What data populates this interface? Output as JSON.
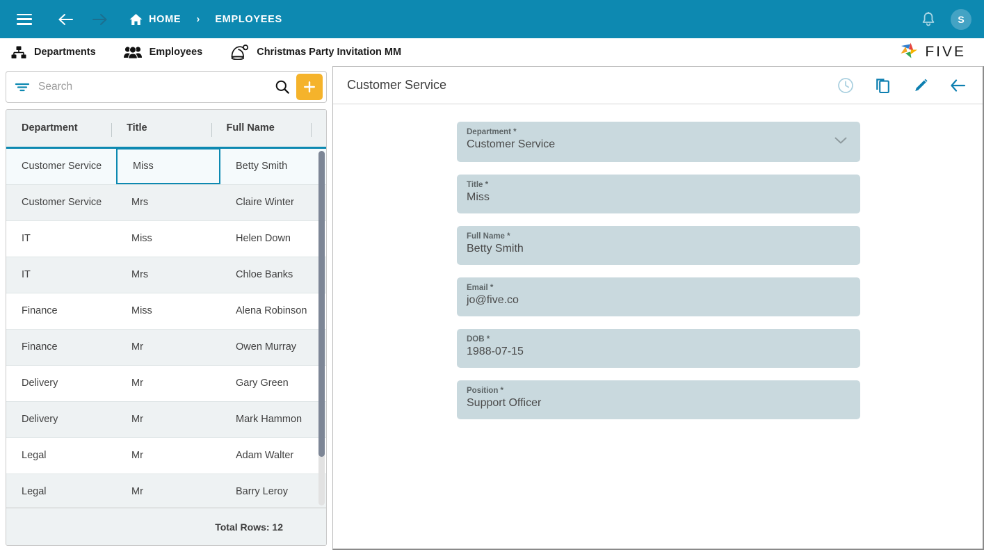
{
  "topbar": {
    "menu_icon": "hamburger-icon",
    "back_icon": "arrow-left-icon",
    "forward_icon": "arrow-right-icon",
    "home_icon": "home-icon",
    "home_label": "HOME",
    "separator": "›",
    "current_label": "EMPLOYEES",
    "notification_icon": "bell-icon",
    "avatar_initial": "S",
    "background_color": "#0d89b1"
  },
  "menubar": {
    "items": [
      {
        "label": "Departments",
        "icon": "sitemap-icon"
      },
      {
        "label": "Employees",
        "icon": "users-group-icon"
      },
      {
        "label": "Christmas Party Invitation MM",
        "icon": "santa-hat-icon"
      }
    ],
    "brand": {
      "name": "FIVE",
      "logo_icon": "five-pinwheel-logo",
      "colors": [
        "#2f7fd0",
        "#e8453c",
        "#f5b400",
        "#34a853"
      ]
    }
  },
  "search": {
    "filter_icon": "filter-icon",
    "placeholder": "Search",
    "value": "",
    "search_icon": "search-icon",
    "add_icon": "plus-icon",
    "add_button_color": "#f5b32b"
  },
  "grid": {
    "columns": [
      "Department",
      "Title",
      "Full Name"
    ],
    "rows": [
      {
        "department": "Customer Service",
        "title": "Miss",
        "full_name": "Betty Smith",
        "selected": true
      },
      {
        "department": "Customer Service",
        "title": "Mrs",
        "full_name": "Claire Winter",
        "selected": false
      },
      {
        "department": "IT",
        "title": "Miss",
        "full_name": "Helen Down",
        "selected": false
      },
      {
        "department": "IT",
        "title": "Mrs",
        "full_name": "Chloe Banks",
        "selected": false
      },
      {
        "department": "Finance",
        "title": "Miss",
        "full_name": "Alena Robinson",
        "selected": false
      },
      {
        "department": "Finance",
        "title": "Mr",
        "full_name": "Owen Murray",
        "selected": false
      },
      {
        "department": "Delivery",
        "title": "Mr",
        "full_name": "Gary Green",
        "selected": false
      },
      {
        "department": "Delivery",
        "title": "Mr",
        "full_name": "Mark Hammon",
        "selected": false
      },
      {
        "department": "Legal",
        "title": "Mr",
        "full_name": "Adam Walter",
        "selected": false
      },
      {
        "department": "Legal",
        "title": "Mr",
        "full_name": "Barry Leroy",
        "selected": false
      }
    ],
    "footer_text": "Total Rows: 12",
    "header_accent_color": "#0d89b1"
  },
  "detail": {
    "title": "Customer Service",
    "actions": [
      {
        "name": "history",
        "icon": "clock-icon"
      },
      {
        "name": "duplicate",
        "icon": "copy-icon"
      },
      {
        "name": "edit",
        "icon": "pencil-icon"
      },
      {
        "name": "back",
        "icon": "arrow-left-icon"
      }
    ],
    "fields": [
      {
        "label": "Department *",
        "value": "Customer Service",
        "type": "dropdown"
      },
      {
        "label": "Title *",
        "value": "Miss",
        "type": "text"
      },
      {
        "label": "Full Name *",
        "value": "Betty Smith",
        "type": "text"
      },
      {
        "label": "Email *",
        "value": "jo@five.co",
        "type": "text"
      },
      {
        "label": "DOB *",
        "value": "1988-07-15",
        "type": "text"
      },
      {
        "label": "Position *",
        "value": "Support Officer",
        "type": "text"
      }
    ],
    "field_background": "#c9d9de"
  }
}
